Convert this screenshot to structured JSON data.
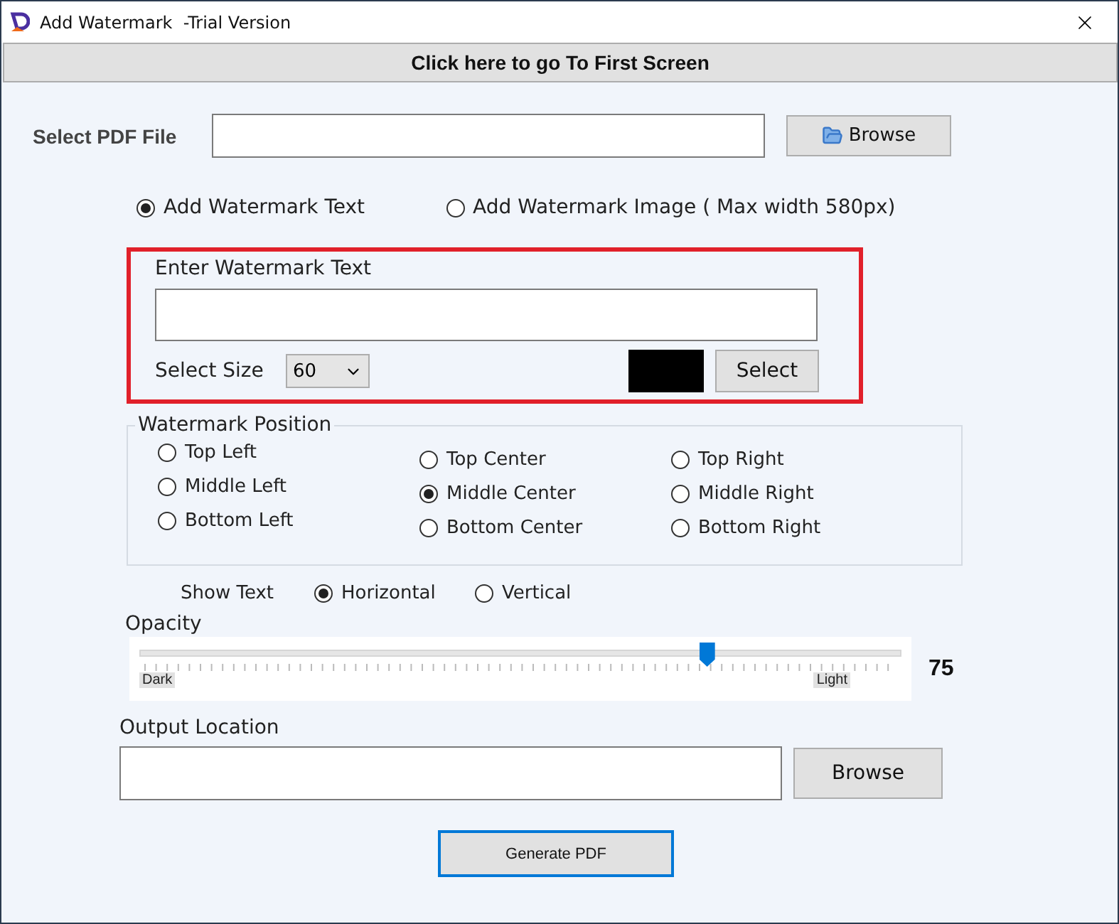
{
  "window": {
    "title": "Add Watermark  -Trial Version"
  },
  "first_screen_button": "Click here to go To First Screen",
  "pdf_file": {
    "label": "Select PDF File",
    "browse_button": "Browse"
  },
  "mode_options": [
    {
      "label": "Add Watermark Text",
      "selected": true
    },
    {
      "label": "Add Watermark Image ( Max width 580px)",
      "selected": false
    }
  ],
  "text_panel": {
    "label": "Enter Watermark Text",
    "size_label": "Select Size",
    "size_value": "60",
    "color": "#000000",
    "select_button": "Select"
  },
  "position": {
    "title": "Watermark Position",
    "options": [
      {
        "label": "Top Left",
        "selected": false
      },
      {
        "label": "Middle Left",
        "selected": false
      },
      {
        "label": "Bottom Left",
        "selected": false
      },
      {
        "label": "Top Center",
        "selected": false
      },
      {
        "label": "Middle Center",
        "selected": true
      },
      {
        "label": "Bottom Center",
        "selected": false
      },
      {
        "label": "Top Right",
        "selected": false
      },
      {
        "label": "Middle Right",
        "selected": false
      },
      {
        "label": "Bottom Right",
        "selected": false
      }
    ]
  },
  "show_text": {
    "label": "Show Text",
    "options": [
      {
        "label": "Horizontal",
        "selected": true
      },
      {
        "label": "Vertical",
        "selected": false
      }
    ]
  },
  "opacity": {
    "label": "Opacity",
    "level": 0.745,
    "value": "75",
    "min_label": "Dark",
    "max_label": "Light"
  },
  "output": {
    "label": "Output Location",
    "browse_button": "Browse"
  },
  "generate_button": "Generate PDF"
}
